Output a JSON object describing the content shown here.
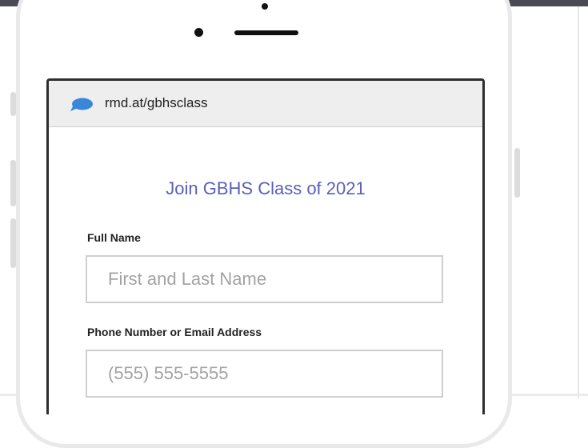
{
  "browser": {
    "url": "rmd.at/gbhsclass",
    "site_icon": "chat-bubble-icon",
    "accent_color": "#3a87d8"
  },
  "form": {
    "title": "Join GBHS Class of 2021",
    "title_color": "#5a5fb8",
    "full_name": {
      "label": "Full Name",
      "placeholder": "First and Last Name"
    },
    "contact": {
      "label": "Phone Number or Email Address",
      "placeholder": "(555) 555-5555"
    }
  }
}
